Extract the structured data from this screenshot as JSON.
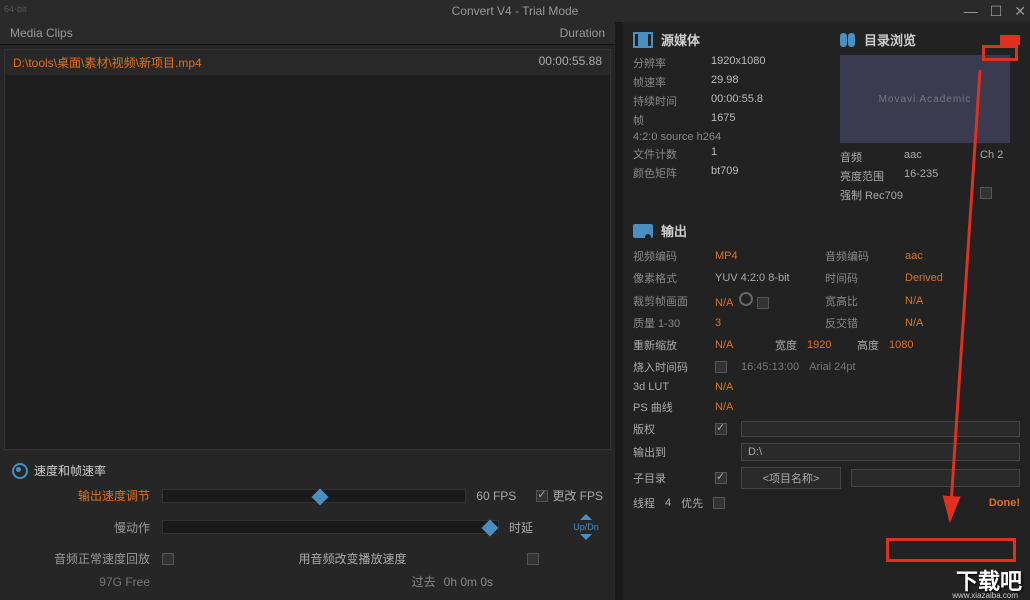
{
  "title": "Convert V4 - Trial Mode",
  "bit_badge": "64-bit",
  "clips": {
    "header_name": "Media Clips",
    "header_duration": "Duration",
    "items": [
      {
        "path": "D:\\tools\\桌面\\素材\\视频\\新项目.mp4",
        "duration": "00:00:55.88"
      }
    ]
  },
  "speed": {
    "title": "速度和帧速率",
    "output_adjust": "输出速度调节",
    "fps_value": "60 FPS",
    "change_fps": "更改 FPS",
    "slomo": "慢动作",
    "delay": "时延",
    "updn": "Up/Dn",
    "playback_normal": "音频正常速度回放",
    "use_audio_speed": "用音频改变播放速度",
    "storage": "97G Free",
    "past": "过去",
    "past_val": "0h 0m 0s"
  },
  "source": {
    "title": "源媒体",
    "resolution_lbl": "分辨率",
    "resolution": "1920x1080",
    "fps_lbl": "帧速率",
    "fps": "29.98",
    "duration_lbl": "持续时间",
    "duration": "00:00:55.8",
    "frames_lbl": "帧",
    "frames": "1675",
    "sampling": "4:2:0 source  h264",
    "files_lbl": "文件计数",
    "files": "1",
    "matrix_lbl": "颜色矩阵",
    "matrix": "bt709"
  },
  "browse": {
    "title": "目录浏览",
    "thumb_text": "Movavi Academic",
    "audio_lbl": "音频",
    "audio": "aac",
    "channels": "Ch 2",
    "range_lbl": "亮度范围",
    "range": "16-235",
    "force_lbl": "强制 Rec709"
  },
  "output": {
    "title": "输出",
    "vcodec_lbl": "视频编码",
    "vcodec": "MP4",
    "acodec_lbl": "音频编码",
    "acodec": "aac",
    "pixfmt_lbl": "像素格式",
    "pixfmt": "YUV 4:2:0 8-bit",
    "tc_lbl": "时间码",
    "tc": "Derived",
    "crop_lbl": "裁剪帧画面",
    "crop": "N/A",
    "aspect_lbl": "宽高比",
    "aspect": "N/A",
    "quality_lbl": "质量 1-30",
    "quality": "3",
    "interlace_lbl": "反交错",
    "interlace": "N/A",
    "rescale_lbl": "重新缩放",
    "rescale": "N/A",
    "width_lbl": "宽度",
    "width": "1920",
    "height_lbl": "高度",
    "height": "1080",
    "burnin_lbl": "烧入时间码",
    "burnin_time": "16:45:13:00",
    "burnin_font": "Arial 24pt",
    "lut_lbl": "3d LUT",
    "lut": "N/A",
    "curve_lbl": "PS 曲线",
    "curve": "N/A",
    "copyright_lbl": "版权",
    "outdir_lbl": "输出到",
    "outdir": "D:\\",
    "subdir_lbl": "子目录",
    "subdir": "<项目名称>"
  },
  "footer": {
    "threads_lbl": "线程",
    "threads": "4",
    "priority_lbl": "优先",
    "done": "Done!"
  },
  "watermark": "下载吧",
  "watermark_url": "www.xiazaiba.com"
}
